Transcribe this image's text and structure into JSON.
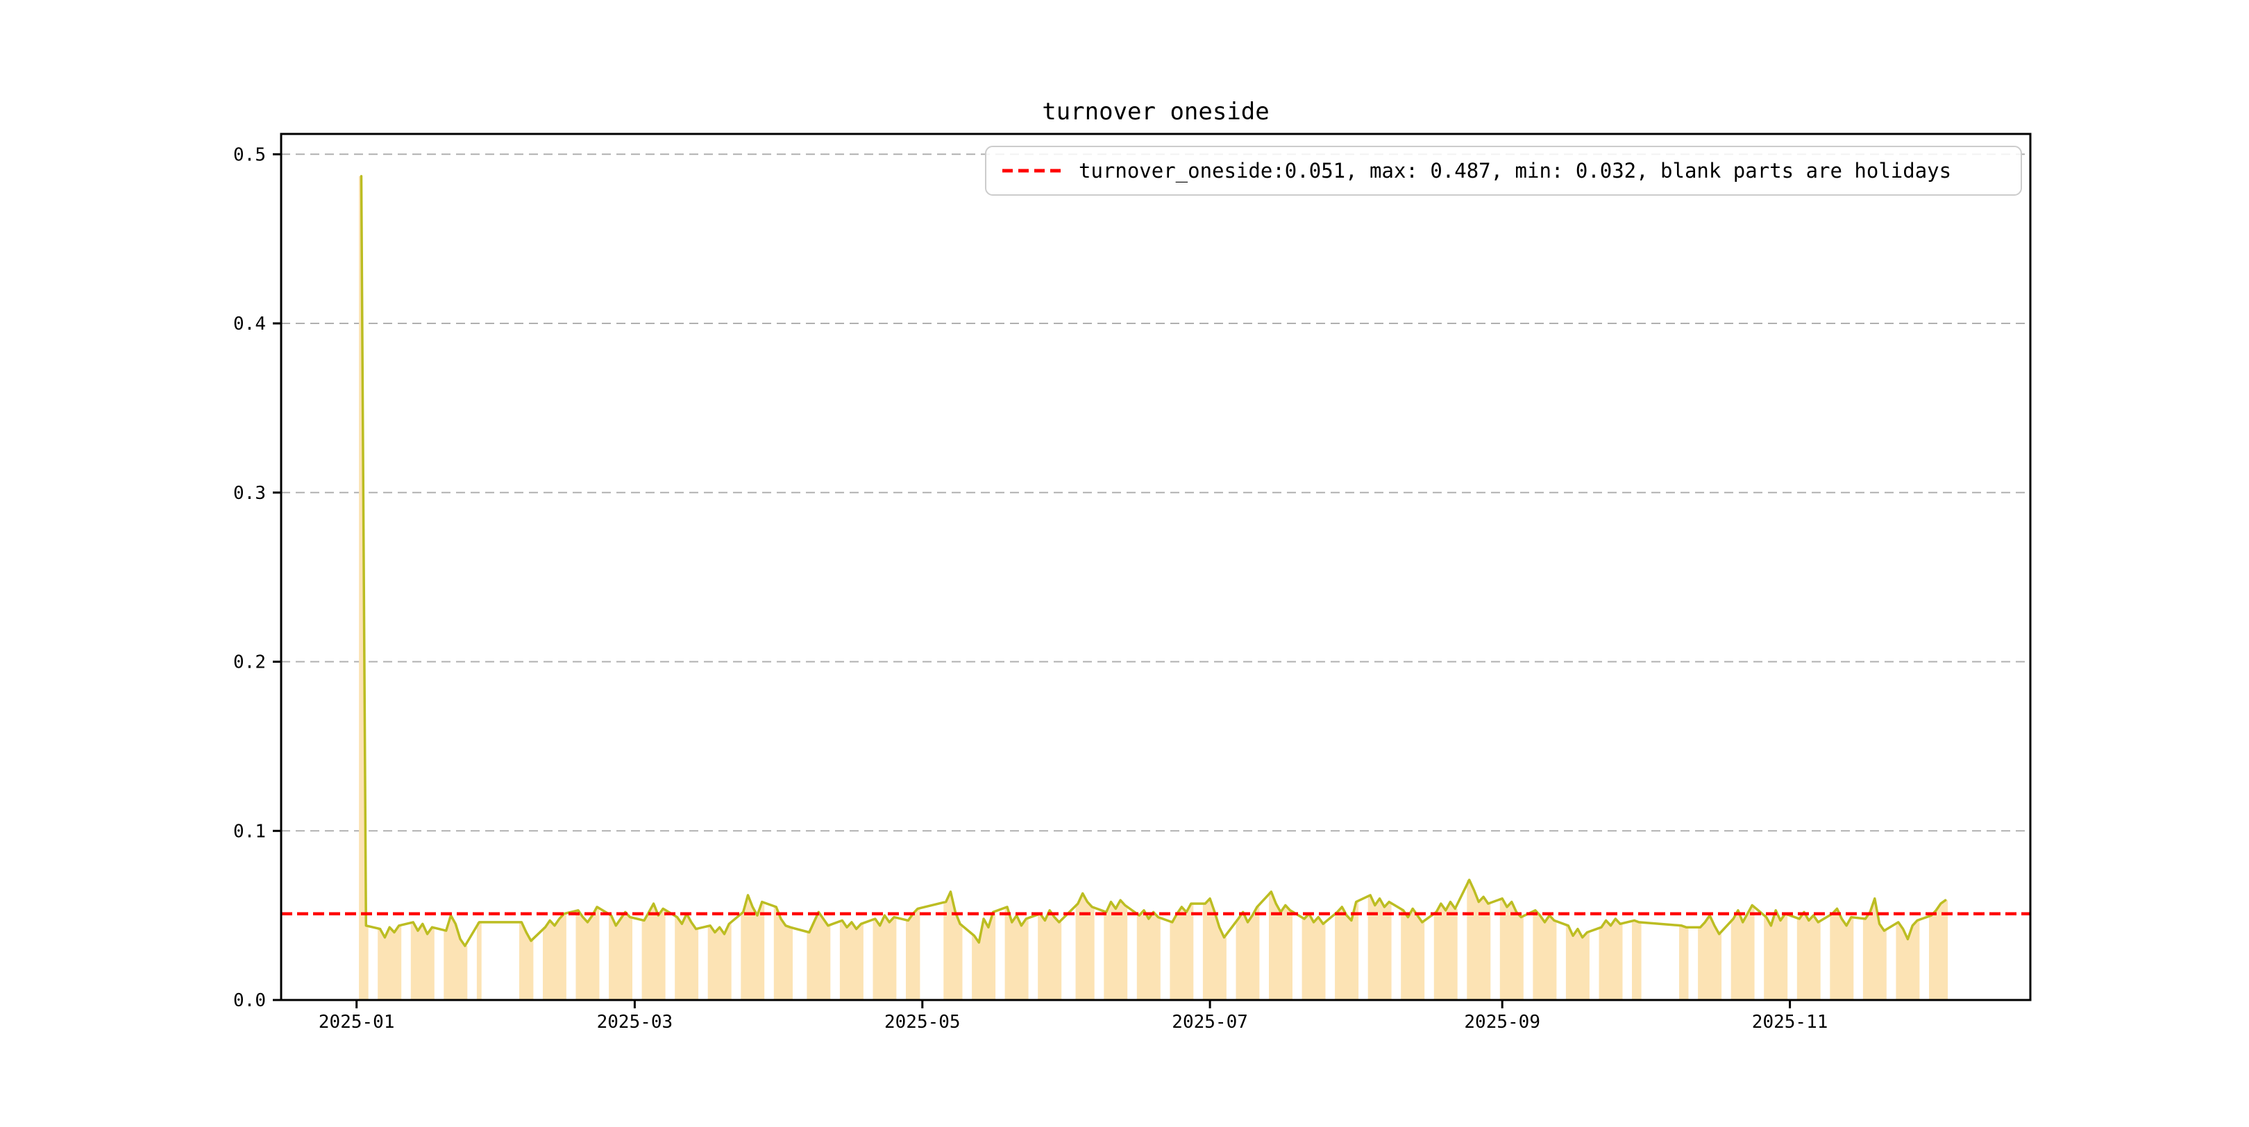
{
  "title": "turnover oneside",
  "legend": {
    "label": "turnover_oneside:0.051, max: 0.487, min: 0.032, blank parts are holidays",
    "sample_color": "#ff0000",
    "sample_style": "dashed"
  },
  "chart_data": {
    "type": "line",
    "title": "turnover oneside",
    "series_name": "turnover_oneside",
    "current": 0.051,
    "max": 0.487,
    "min": 0.032,
    "reference_line": 0.051,
    "note": "blank parts are holidays",
    "grid": true,
    "legend_position": "top-right",
    "ylim": [
      0.0,
      0.512
    ],
    "yticks": [
      0.0,
      0.1,
      0.2,
      0.3,
      0.4,
      0.5
    ],
    "ytick_labels": [
      "0.0",
      "0.1",
      "0.2",
      "0.3",
      "0.4",
      "0.5"
    ],
    "xlim": [
      "2024-12-16",
      "2025-12-22"
    ],
    "xticks": [
      "2025-01-01",
      "2025-03-01",
      "2025-05-01",
      "2025-07-01",
      "2025-09-01",
      "2025-11-01"
    ],
    "xtick_labels": [
      "2025-01",
      "2025-03",
      "2025-05",
      "2025-07",
      "2025-09",
      "2025-11"
    ],
    "line_color": "#bcbd22",
    "band_color": "#fce3b4",
    "reference_color": "#ff0000",
    "grid_color": "#b0b0b0",
    "weeks": [
      {
        "start": "2025-01-02",
        "values": [
          0.487,
          0.044
        ]
      },
      {
        "start": "2025-01-06",
        "values": [
          0.042,
          0.037,
          0.043,
          0.04,
          0.044
        ]
      },
      {
        "start": "2025-01-13",
        "values": [
          0.046,
          0.041,
          0.045,
          0.039,
          0.043
        ]
      },
      {
        "start": "2025-01-20",
        "values": [
          0.041,
          0.05,
          0.045,
          0.036,
          0.032
        ]
      },
      {
        "start": "2025-01-27",
        "values": [
          0.046
        ]
      },
      {
        "start": "2025-02-05",
        "values": [
          0.046,
          0.04,
          0.035
        ]
      },
      {
        "start": "2025-02-10",
        "values": [
          0.043,
          0.047,
          0.044,
          0.048,
          0.051
        ]
      },
      {
        "start": "2025-02-17",
        "values": [
          0.053,
          0.049,
          0.046,
          0.05,
          0.055
        ]
      },
      {
        "start": "2025-02-24",
        "values": [
          0.05,
          0.044,
          0.048,
          0.052,
          0.049
        ]
      },
      {
        "start": "2025-03-03",
        "values": [
          0.047,
          0.052,
          0.057,
          0.05,
          0.054
        ]
      },
      {
        "start": "2025-03-10",
        "values": [
          0.049,
          0.045,
          0.051,
          0.046,
          0.042
        ]
      },
      {
        "start": "2025-03-17",
        "values": [
          0.044,
          0.04,
          0.043,
          0.039,
          0.045
        ]
      },
      {
        "start": "2025-03-24",
        "values": [
          0.052,
          0.062,
          0.055,
          0.05,
          0.058
        ]
      },
      {
        "start": "2025-03-31",
        "values": [
          0.055,
          0.048,
          0.044,
          0.043
        ]
      },
      {
        "start": "2025-04-07",
        "values": [
          0.04,
          0.046,
          0.052,
          0.048,
          0.044
        ]
      },
      {
        "start": "2025-04-14",
        "values": [
          0.047,
          0.043,
          0.046,
          0.042,
          0.045
        ]
      },
      {
        "start": "2025-04-21",
        "values": [
          0.048,
          0.044,
          0.05,
          0.046,
          0.049
        ]
      },
      {
        "start": "2025-04-28",
        "values": [
          0.047,
          0.051,
          0.054
        ]
      },
      {
        "start": "2025-05-06",
        "values": [
          0.058,
          0.064,
          0.052,
          0.045
        ]
      },
      {
        "start": "2025-05-12",
        "values": [
          0.038,
          0.034,
          0.048,
          0.043,
          0.052
        ]
      },
      {
        "start": "2025-05-19",
        "values": [
          0.055,
          0.046,
          0.05,
          0.044,
          0.048
        ]
      },
      {
        "start": "2025-05-26",
        "values": [
          0.051,
          0.047,
          0.053,
          0.049,
          0.046
        ]
      },
      {
        "start": "2025-06-03",
        "values": [
          0.057,
          0.063,
          0.058,
          0.055
        ]
      },
      {
        "start": "2025-06-09",
        "values": [
          0.052,
          0.058,
          0.054,
          0.059,
          0.056
        ]
      },
      {
        "start": "2025-06-16",
        "values": [
          0.05,
          0.053,
          0.048,
          0.052,
          0.049
        ]
      },
      {
        "start": "2025-06-23",
        "values": [
          0.046,
          0.051,
          0.055,
          0.052,
          0.057
        ]
      },
      {
        "start": "2025-06-30",
        "values": [
          0.057,
          0.06,
          0.052,
          0.043,
          0.037
        ]
      },
      {
        "start": "2025-07-07",
        "values": [
          0.048,
          0.052,
          0.046,
          0.05,
          0.055
        ]
      },
      {
        "start": "2025-07-14",
        "values": [
          0.064,
          0.057,
          0.052,
          0.056,
          0.053
        ]
      },
      {
        "start": "2025-07-21",
        "values": [
          0.048,
          0.051,
          0.046,
          0.049,
          0.045
        ]
      },
      {
        "start": "2025-07-28",
        "values": [
          0.052,
          0.055,
          0.05,
          0.047,
          0.058
        ]
      },
      {
        "start": "2025-08-04",
        "values": [
          0.062,
          0.056,
          0.06,
          0.055,
          0.058
        ]
      },
      {
        "start": "2025-08-11",
        "values": [
          0.053,
          0.049,
          0.054,
          0.05,
          0.046
        ]
      },
      {
        "start": "2025-08-18",
        "values": [
          0.052,
          0.057,
          0.053,
          0.058,
          0.054
        ]
      },
      {
        "start": "2025-08-25",
        "values": [
          0.071,
          0.065,
          0.058,
          0.061,
          0.057
        ]
      },
      {
        "start": "2025-09-01",
        "values": [
          0.06,
          0.055,
          0.058,
          0.052,
          0.049
        ]
      },
      {
        "start": "2025-09-08",
        "values": [
          0.053,
          0.05,
          0.046,
          0.05,
          0.047
        ]
      },
      {
        "start": "2025-09-15",
        "values": [
          0.044,
          0.038,
          0.042,
          0.037,
          0.04
        ]
      },
      {
        "start": "2025-09-22",
        "values": [
          0.043,
          0.047,
          0.044,
          0.048,
          0.045
        ]
      },
      {
        "start": "2025-09-29",
        "values": [
          0.047,
          0.046
        ]
      },
      {
        "start": "2025-10-09",
        "values": [
          0.044,
          0.043
        ]
      },
      {
        "start": "2025-10-13",
        "values": [
          0.043,
          0.046,
          0.05,
          0.044,
          0.039
        ]
      },
      {
        "start": "2025-10-20",
        "values": [
          0.048,
          0.053,
          0.046,
          0.051,
          0.056
        ]
      },
      {
        "start": "2025-10-27",
        "values": [
          0.049,
          0.044,
          0.053,
          0.047,
          0.051
        ]
      },
      {
        "start": "2025-11-03",
        "values": [
          0.048,
          0.052,
          0.047,
          0.05,
          0.046
        ]
      },
      {
        "start": "2025-11-10",
        "values": [
          0.051,
          0.054,
          0.048,
          0.044,
          0.049
        ]
      },
      {
        "start": "2025-11-17",
        "values": [
          0.048,
          0.052,
          0.06,
          0.045,
          0.041
        ]
      },
      {
        "start": "2025-11-24",
        "values": [
          0.046,
          0.042,
          0.036,
          0.044,
          0.047
        ]
      },
      {
        "start": "2025-12-01",
        "values": [
          0.05,
          0.053,
          0.057,
          0.059
        ]
      }
    ]
  }
}
